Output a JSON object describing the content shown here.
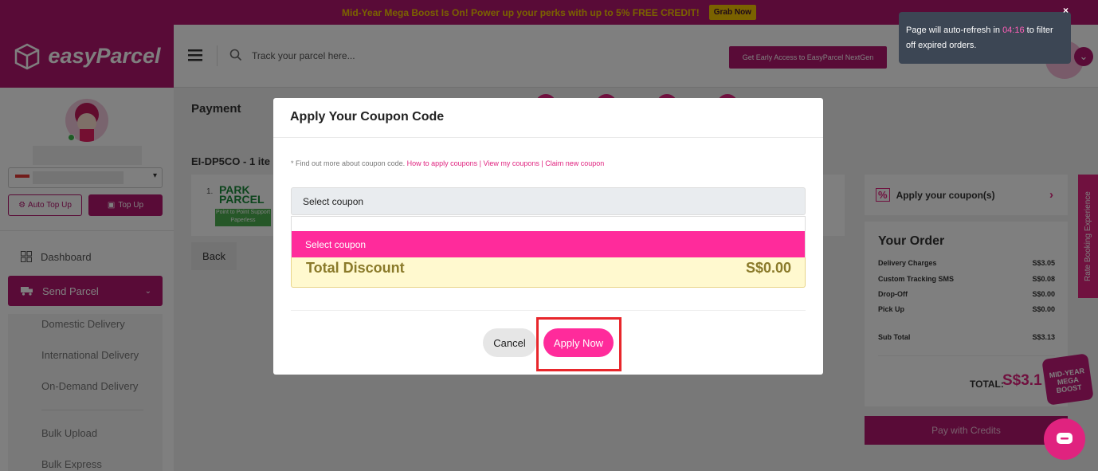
{
  "promo": {
    "text": "Mid-Year Mega Boost Is On! Power up your perks with up to 5% FREE CREDIT!",
    "button": "Grab Now"
  },
  "brand": {
    "name": "easyParcel",
    "color": "#b3176e",
    "accent": "#e0237f"
  },
  "topbar": {
    "search_placeholder": "Track your parcel here...",
    "early_access": "Get Early Access to EasyParcel NextGen"
  },
  "toast": {
    "prefix": "Page will auto-refresh in ",
    "time": "04:16",
    "suffix": " to filter off expired orders.",
    "close": "×"
  },
  "sidebar": {
    "auto_top_up": "Auto Top Up",
    "top_up": "Top Up",
    "nav": [
      {
        "label": "Dashboard",
        "icon": "dashboard-icon"
      },
      {
        "label": "Send Parcel",
        "icon": "truck-icon"
      }
    ],
    "sub_nav": [
      "Domestic Delivery",
      "International Delivery",
      "On-Demand Delivery",
      "Bulk Upload",
      "Bulk Express"
    ]
  },
  "main": {
    "title": "Payment",
    "order_id": "EI-DP5CO - 1 ite",
    "item_index": "1.",
    "courier": {
      "name_line1": "PARK",
      "name_line2": "PARCEL",
      "badge": "Point to Point Support Paperless"
    },
    "back": "Back"
  },
  "right": {
    "coupon_label": "Apply your coupon(s)",
    "order_title": "Your Order",
    "rows": [
      {
        "label": "Delivery Charges",
        "value": "S$3.05"
      },
      {
        "label": "Custom Tracking SMS",
        "value": "S$0.08"
      },
      {
        "label": "Drop-Off",
        "value": "S$0.00"
      },
      {
        "label": "Pick Up",
        "value": "S$0.00"
      }
    ],
    "subtotal_label": "Sub Total",
    "subtotal_value": "S$3.13",
    "total_label": "TOTAL:",
    "total_value": "S$3.1",
    "pay_button": "Pay with Credits",
    "boost_badge": "MID-YEAR MEGA BOOST",
    "rate_tab": "Rate Booking Experience"
  },
  "modal": {
    "title": "Apply Your Coupon Code",
    "note_prefix": "* Find out more about coupon code. ",
    "link1": "How to apply coupons",
    "sep": " | ",
    "link2": "View my coupons",
    "link3": "Claim new coupon",
    "select_value": "Select coupon",
    "dropdown_option": "Select coupon",
    "discount_label": "Total Discount",
    "discount_value": "S$0.00",
    "cancel": "Cancel",
    "apply": "Apply Now"
  }
}
